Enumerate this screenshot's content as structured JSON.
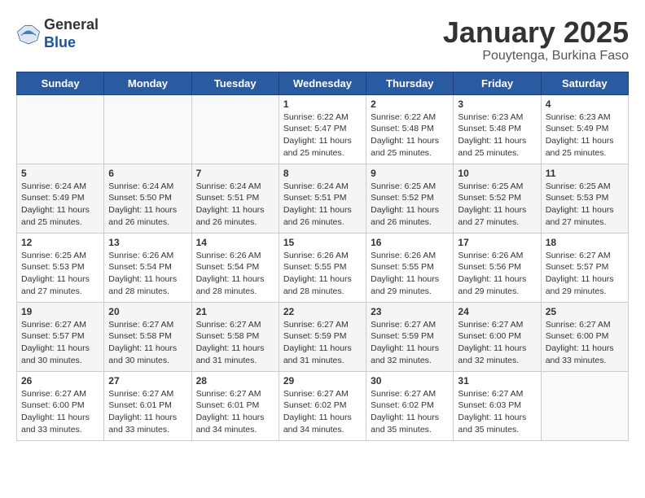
{
  "header": {
    "logo_general": "General",
    "logo_blue": "Blue",
    "title": "January 2025",
    "subtitle": "Pouytenga, Burkina Faso"
  },
  "days_of_week": [
    "Sunday",
    "Monday",
    "Tuesday",
    "Wednesday",
    "Thursday",
    "Friday",
    "Saturday"
  ],
  "weeks": [
    [
      {
        "num": "",
        "sunrise": "",
        "sunset": "",
        "daylight": ""
      },
      {
        "num": "",
        "sunrise": "",
        "sunset": "",
        "daylight": ""
      },
      {
        "num": "",
        "sunrise": "",
        "sunset": "",
        "daylight": ""
      },
      {
        "num": "1",
        "sunrise": "Sunrise: 6:22 AM",
        "sunset": "Sunset: 5:47 PM",
        "daylight": "Daylight: 11 hours and 25 minutes."
      },
      {
        "num": "2",
        "sunrise": "Sunrise: 6:22 AM",
        "sunset": "Sunset: 5:48 PM",
        "daylight": "Daylight: 11 hours and 25 minutes."
      },
      {
        "num": "3",
        "sunrise": "Sunrise: 6:23 AM",
        "sunset": "Sunset: 5:48 PM",
        "daylight": "Daylight: 11 hours and 25 minutes."
      },
      {
        "num": "4",
        "sunrise": "Sunrise: 6:23 AM",
        "sunset": "Sunset: 5:49 PM",
        "daylight": "Daylight: 11 hours and 25 minutes."
      }
    ],
    [
      {
        "num": "5",
        "sunrise": "Sunrise: 6:24 AM",
        "sunset": "Sunset: 5:49 PM",
        "daylight": "Daylight: 11 hours and 25 minutes."
      },
      {
        "num": "6",
        "sunrise": "Sunrise: 6:24 AM",
        "sunset": "Sunset: 5:50 PM",
        "daylight": "Daylight: 11 hours and 26 minutes."
      },
      {
        "num": "7",
        "sunrise": "Sunrise: 6:24 AM",
        "sunset": "Sunset: 5:51 PM",
        "daylight": "Daylight: 11 hours and 26 minutes."
      },
      {
        "num": "8",
        "sunrise": "Sunrise: 6:24 AM",
        "sunset": "Sunset: 5:51 PM",
        "daylight": "Daylight: 11 hours and 26 minutes."
      },
      {
        "num": "9",
        "sunrise": "Sunrise: 6:25 AM",
        "sunset": "Sunset: 5:52 PM",
        "daylight": "Daylight: 11 hours and 26 minutes."
      },
      {
        "num": "10",
        "sunrise": "Sunrise: 6:25 AM",
        "sunset": "Sunset: 5:52 PM",
        "daylight": "Daylight: 11 hours and 27 minutes."
      },
      {
        "num": "11",
        "sunrise": "Sunrise: 6:25 AM",
        "sunset": "Sunset: 5:53 PM",
        "daylight": "Daylight: 11 hours and 27 minutes."
      }
    ],
    [
      {
        "num": "12",
        "sunrise": "Sunrise: 6:25 AM",
        "sunset": "Sunset: 5:53 PM",
        "daylight": "Daylight: 11 hours and 27 minutes."
      },
      {
        "num": "13",
        "sunrise": "Sunrise: 6:26 AM",
        "sunset": "Sunset: 5:54 PM",
        "daylight": "Daylight: 11 hours and 28 minutes."
      },
      {
        "num": "14",
        "sunrise": "Sunrise: 6:26 AM",
        "sunset": "Sunset: 5:54 PM",
        "daylight": "Daylight: 11 hours and 28 minutes."
      },
      {
        "num": "15",
        "sunrise": "Sunrise: 6:26 AM",
        "sunset": "Sunset: 5:55 PM",
        "daylight": "Daylight: 11 hours and 28 minutes."
      },
      {
        "num": "16",
        "sunrise": "Sunrise: 6:26 AM",
        "sunset": "Sunset: 5:55 PM",
        "daylight": "Daylight: 11 hours and 29 minutes."
      },
      {
        "num": "17",
        "sunrise": "Sunrise: 6:26 AM",
        "sunset": "Sunset: 5:56 PM",
        "daylight": "Daylight: 11 hours and 29 minutes."
      },
      {
        "num": "18",
        "sunrise": "Sunrise: 6:27 AM",
        "sunset": "Sunset: 5:57 PM",
        "daylight": "Daylight: 11 hours and 29 minutes."
      }
    ],
    [
      {
        "num": "19",
        "sunrise": "Sunrise: 6:27 AM",
        "sunset": "Sunset: 5:57 PM",
        "daylight": "Daylight: 11 hours and 30 minutes."
      },
      {
        "num": "20",
        "sunrise": "Sunrise: 6:27 AM",
        "sunset": "Sunset: 5:58 PM",
        "daylight": "Daylight: 11 hours and 30 minutes."
      },
      {
        "num": "21",
        "sunrise": "Sunrise: 6:27 AM",
        "sunset": "Sunset: 5:58 PM",
        "daylight": "Daylight: 11 hours and 31 minutes."
      },
      {
        "num": "22",
        "sunrise": "Sunrise: 6:27 AM",
        "sunset": "Sunset: 5:59 PM",
        "daylight": "Daylight: 11 hours and 31 minutes."
      },
      {
        "num": "23",
        "sunrise": "Sunrise: 6:27 AM",
        "sunset": "Sunset: 5:59 PM",
        "daylight": "Daylight: 11 hours and 32 minutes."
      },
      {
        "num": "24",
        "sunrise": "Sunrise: 6:27 AM",
        "sunset": "Sunset: 6:00 PM",
        "daylight": "Daylight: 11 hours and 32 minutes."
      },
      {
        "num": "25",
        "sunrise": "Sunrise: 6:27 AM",
        "sunset": "Sunset: 6:00 PM",
        "daylight": "Daylight: 11 hours and 33 minutes."
      }
    ],
    [
      {
        "num": "26",
        "sunrise": "Sunrise: 6:27 AM",
        "sunset": "Sunset: 6:00 PM",
        "daylight": "Daylight: 11 hours and 33 minutes."
      },
      {
        "num": "27",
        "sunrise": "Sunrise: 6:27 AM",
        "sunset": "Sunset: 6:01 PM",
        "daylight": "Daylight: 11 hours and 33 minutes."
      },
      {
        "num": "28",
        "sunrise": "Sunrise: 6:27 AM",
        "sunset": "Sunset: 6:01 PM",
        "daylight": "Daylight: 11 hours and 34 minutes."
      },
      {
        "num": "29",
        "sunrise": "Sunrise: 6:27 AM",
        "sunset": "Sunset: 6:02 PM",
        "daylight": "Daylight: 11 hours and 34 minutes."
      },
      {
        "num": "30",
        "sunrise": "Sunrise: 6:27 AM",
        "sunset": "Sunset: 6:02 PM",
        "daylight": "Daylight: 11 hours and 35 minutes."
      },
      {
        "num": "31",
        "sunrise": "Sunrise: 6:27 AM",
        "sunset": "Sunset: 6:03 PM",
        "daylight": "Daylight: 11 hours and 35 minutes."
      },
      {
        "num": "",
        "sunrise": "",
        "sunset": "",
        "daylight": ""
      }
    ]
  ]
}
